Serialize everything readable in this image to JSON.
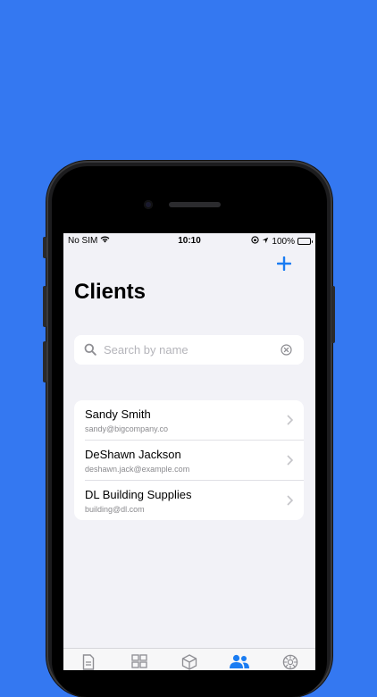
{
  "status_bar": {
    "carrier": "No SIM",
    "time": "10:10",
    "battery": "100%",
    "icons": [
      "wifi-icon",
      "lock-rotation-icon",
      "location-icon",
      "battery-icon"
    ]
  },
  "header": {
    "add_icon": "plus-icon",
    "title": "Clients"
  },
  "search": {
    "placeholder": "Search by name",
    "value": ""
  },
  "clients": [
    {
      "name": "Sandy Smith",
      "email": "sandy@bigcompany.co"
    },
    {
      "name": "DeShawn Jackson",
      "email": "deshawn.jack@example.com"
    },
    {
      "name": "DL Building Supplies",
      "email": "building@dl.com"
    }
  ],
  "tabbar": {
    "tabs": [
      {
        "icon": "document-icon",
        "selected": false
      },
      {
        "icon": "grid-icon",
        "selected": false
      },
      {
        "icon": "box-icon",
        "selected": false
      },
      {
        "icon": "people-icon",
        "selected": true
      },
      {
        "icon": "settings-icon",
        "selected": false
      }
    ]
  },
  "colors": {
    "background": "#3478f1",
    "accent": "#1a7cf2",
    "screen": "#f2f2f7",
    "battery": "#34c759"
  }
}
